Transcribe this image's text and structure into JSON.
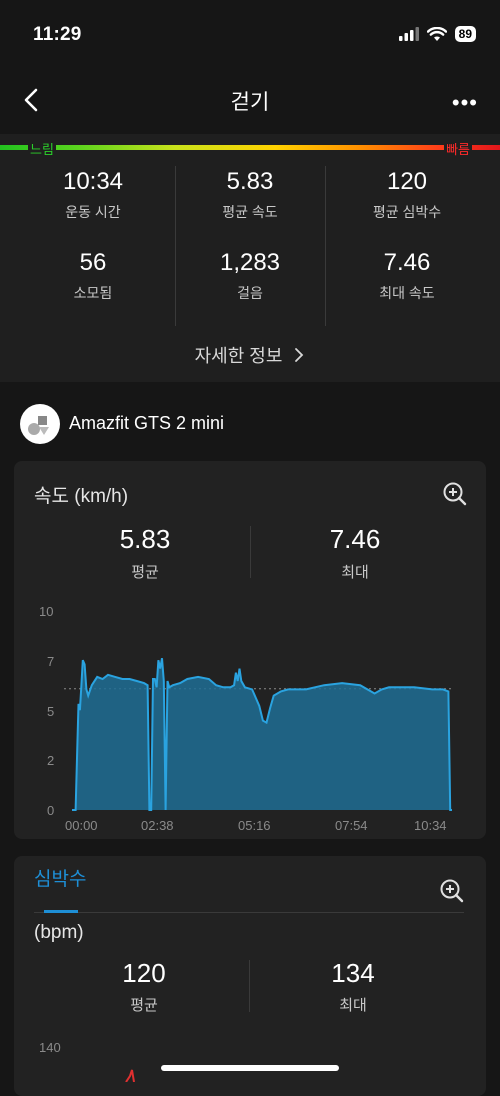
{
  "status": {
    "time": "11:29",
    "battery": "89"
  },
  "nav": {
    "title": "걷기",
    "more": "•••"
  },
  "pace_bar": {
    "slow_label": "느림",
    "fast_label": "빠름"
  },
  "stats": [
    {
      "value": "10:34",
      "label": "운동 시간"
    },
    {
      "value": "5.83",
      "label": "평균 속도"
    },
    {
      "value": "120",
      "label": "평균 심박수"
    },
    {
      "value": "56",
      "label": "소모됨"
    },
    {
      "value": "1,283",
      "label": "걸음"
    },
    {
      "value": "7.46",
      "label": "최대 속도"
    }
  ],
  "details_link": "자세한 정보",
  "device": {
    "name": "Amazfit GTS 2 mini"
  },
  "speed_card": {
    "title": "속도 (km/h)",
    "avg_value": "5.83",
    "avg_label": "평균",
    "max_value": "7.46",
    "max_label": "최대",
    "y_ticks": [
      "10",
      "7",
      "5",
      "2",
      "0"
    ],
    "x_ticks": [
      "00:00",
      "02:38",
      "05:16",
      "07:54",
      "10:34"
    ]
  },
  "hr_card": {
    "tab": "심박수",
    "unit": "(bpm)",
    "avg_value": "120",
    "avg_label": "평균",
    "max_value": "134",
    "max_label": "최대",
    "y_tick_top": "140"
  },
  "colors": {
    "accent": "#1e8fd6",
    "chart_fill": "#1e6d94",
    "chart_line": "#2aa3e0",
    "hr_line": "#e03030"
  },
  "chart_data": {
    "type": "area",
    "title": "속도 (km/h)",
    "xlabel": "",
    "ylabel": "",
    "ylim": [
      0,
      10
    ],
    "x_ticks": [
      "00:00",
      "02:38",
      "05:16",
      "07:54",
      "10:34"
    ],
    "average": 5.83,
    "x": [
      0,
      0.1,
      0.15,
      0.18,
      0.22,
      0.26,
      0.3,
      0.35,
      0.4,
      0.45,
      0.55,
      0.7,
      0.85,
      1.0,
      1.2,
      1.4,
      1.6,
      1.8,
      2.0,
      2.1,
      2.15,
      2.2,
      2.25,
      2.3,
      2.35,
      2.4,
      2.45,
      2.5,
      2.55,
      2.6,
      2.65,
      2.7,
      2.8,
      3.0,
      3.2,
      3.5,
      3.8,
      4.0,
      4.2,
      4.4,
      4.5,
      4.55,
      4.6,
      4.65,
      4.7,
      4.8,
      5.0,
      5.2,
      5.3,
      5.4,
      5.5,
      5.6,
      5.8,
      6.0,
      6.5,
      7.0,
      7.5,
      8.0,
      8.2,
      8.4,
      8.6,
      8.8,
      9.0,
      9.5,
      10.0,
      10.3,
      10.45,
      10.5,
      10.55
    ],
    "y": [
      0,
      0,
      3.2,
      5.1,
      4.8,
      6.0,
      7.2,
      7.0,
      5.8,
      5.5,
      6.0,
      6.4,
      6.3,
      6.5,
      6.4,
      6.3,
      6.3,
      6.2,
      6.1,
      6.0,
      0,
      0,
      6.3,
      6.3,
      5.9,
      7.2,
      6.8,
      7.3,
      6.2,
      0,
      6.2,
      5.9,
      6.0,
      6.1,
      6.3,
      6.4,
      6.3,
      6.0,
      5.9,
      5.9,
      6.0,
      6.6,
      6.2,
      6.8,
      6.2,
      5.9,
      5.8,
      5.0,
      4.3,
      4.2,
      4.9,
      5.5,
      5.7,
      5.8,
      5.8,
      6.0,
      6.1,
      6.0,
      5.8,
      5.6,
      5.8,
      5.9,
      5.9,
      5.9,
      5.8,
      5.8,
      5.7,
      0,
      0
    ]
  }
}
